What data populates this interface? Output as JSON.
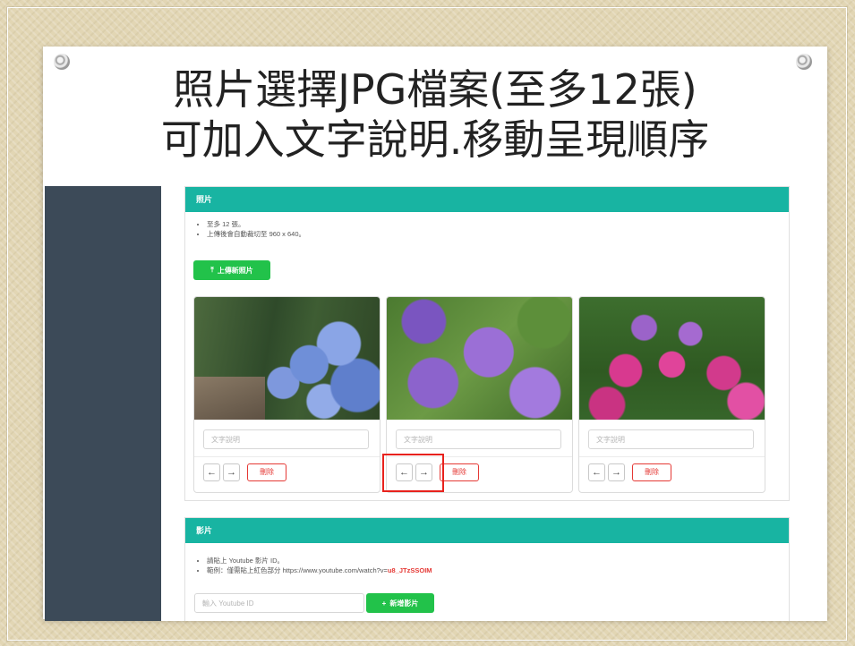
{
  "slide": {
    "title_line1": "照片選擇JPG檔案(至多12張)",
    "title_line2": "可加入文字說明.移動呈現順序"
  },
  "photos_section": {
    "header": "照片",
    "notes": [
      "至多 12 張。",
      "上傳後會自動裁切至 960 x 640。"
    ],
    "upload_button": "上傳新照片",
    "upload_icon": "upload-icon",
    "photos": [
      {
        "alt": "hydrangea-path",
        "caption_placeholder": "文字說明",
        "prev": "←",
        "next": "→",
        "delete": "刪除"
      },
      {
        "alt": "purple-hydrangea",
        "caption_placeholder": "文字說明",
        "prev": "←",
        "next": "→",
        "delete": "刪除"
      },
      {
        "alt": "pink-hydrangea",
        "caption_placeholder": "文字說明",
        "prev": "←",
        "next": "→",
        "delete": "刪除"
      }
    ]
  },
  "video_section": {
    "header": "影片",
    "note1": "請貼上 Youtube 影片 ID。",
    "note2_prefix": "範例：僅需貼上紅色部分 https://www.youtube.com/watch?v=",
    "note2_highlight": "u8_JTzSSOIM",
    "input_placeholder": "輸入 Youtube ID",
    "add_button": "新增影片",
    "add_icon": "+"
  },
  "colors": {
    "header_teal": "#18b4a2",
    "sidebar": "#3c4a58",
    "green_button": "#22c24a",
    "delete_red": "#e53935",
    "highlight": "#e8221d"
  }
}
